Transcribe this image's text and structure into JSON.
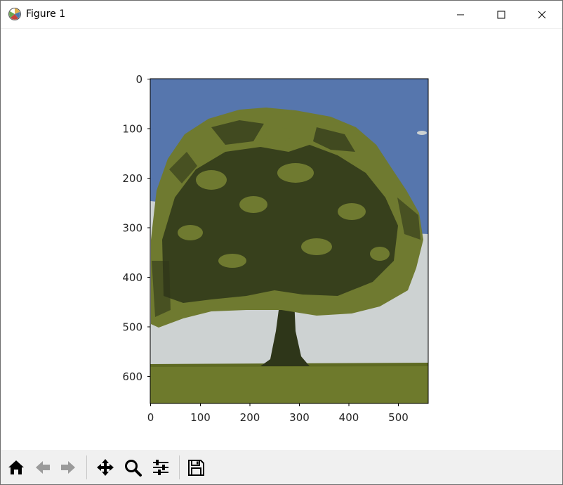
{
  "window": {
    "title": "Figure 1"
  },
  "icons": {
    "app": "matplotlib-figure-icon",
    "minimize": "minimize-icon",
    "maximize": "maximize-icon",
    "close": "close-icon"
  },
  "toolbar": {
    "buttons": [
      {
        "name": "home-button",
        "icon": "home-icon"
      },
      {
        "name": "back-button",
        "icon": "back-arrow-icon"
      },
      {
        "name": "forward-button",
        "icon": "forward-arrow-icon"
      },
      {
        "name": "pan-button",
        "icon": "move-icon"
      },
      {
        "name": "zoom-button",
        "icon": "magnifier-icon"
      },
      {
        "name": "configure-subplots-button",
        "icon": "sliders-icon"
      },
      {
        "name": "save-button",
        "icon": "floppy-disk-icon"
      }
    ]
  },
  "plot": {
    "x_ticks": [
      "0",
      "100",
      "200",
      "300",
      "400",
      "500"
    ],
    "y_ticks": [
      "0",
      "100",
      "200",
      "300",
      "400",
      "500",
      "600"
    ],
    "image_subject": "tree-photo",
    "colors": {
      "sky": "#5676ad",
      "haze": "#cdd2d2",
      "grass": "#6e7a2c",
      "foliage_light": "#6f7a30",
      "foliage_dark": "#2e3619"
    }
  }
}
